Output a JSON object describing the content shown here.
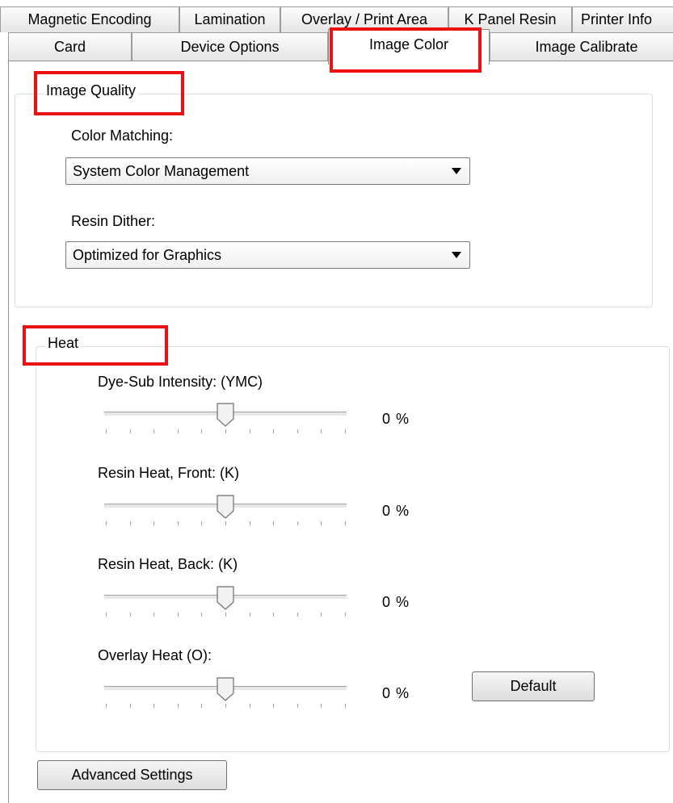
{
  "tabs": {
    "row1": [
      "Magnetic Encoding",
      "Lamination",
      "Overlay / Print Area",
      "K Panel Resin",
      "Printer Info"
    ],
    "row2": [
      "Card",
      "Device Options",
      "Image Color",
      "Image Calibrate"
    ],
    "active": "Image Color"
  },
  "image_quality": {
    "title": "Image Quality",
    "color_matching_label": "Color Matching:",
    "color_matching_value": "System Color Management",
    "resin_dither_label": "Resin Dither:",
    "resin_dither_value": "Optimized for Graphics"
  },
  "heat": {
    "title": "Heat",
    "sliders": [
      {
        "label": "Dye-Sub Intensity: (YMC)",
        "value": 0,
        "display": "0 %"
      },
      {
        "label": "Resin Heat, Front: (K)",
        "value": 0,
        "display": "0 %"
      },
      {
        "label": "Resin Heat, Back: (K)",
        "value": 0,
        "display": "0 %"
      },
      {
        "label": "Overlay Heat  (O):",
        "value": 0,
        "display": "0 %"
      }
    ],
    "default_button": "Default"
  },
  "advanced_button": "Advanced Settings",
  "colors": {
    "highlight": "#ee1111",
    "group_border": "#d5dfe5",
    "tab_border": "#9c9c9c"
  }
}
